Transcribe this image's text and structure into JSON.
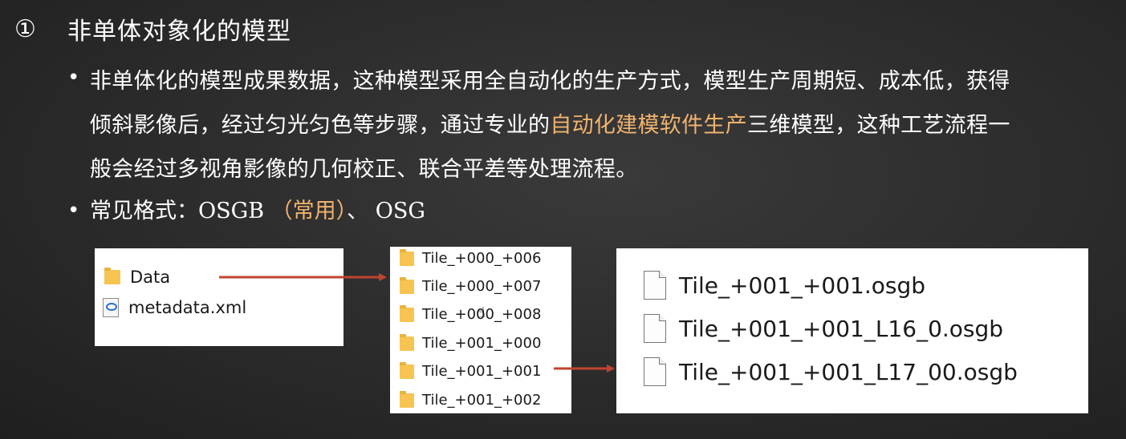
{
  "heading": {
    "number": "①",
    "title": "非单体对象化的模型"
  },
  "bullet_symbol": "•",
  "paragraph": {
    "line1": "非单体化的模型成果数据，这种模型采用全自动化的生产方式，模型生产周期短、成本低，获得",
    "line2_pre": "倾斜影像后，经过匀光匀色等步骤，通过专业的",
    "line2_highlight": "自动化建模软件生产",
    "line2_post": "三维模型，这种工艺流程一",
    "line3": "般会经过多视角影像的几何校正、联合平差等处理流程。"
  },
  "formats": {
    "label": "常见格式：",
    "osgb": "OSGB",
    "common_note": "（常用）",
    "separator": "、",
    "osg": "OSG"
  },
  "panel_root": {
    "items": [
      {
        "label": "Data",
        "icon": "folder-icon"
      },
      {
        "label": "metadata.xml",
        "icon": "xml-file-icon"
      }
    ]
  },
  "panel_tiles": {
    "items": [
      "Tile_+000_+006",
      "Tile_+000_+007",
      "Tile_+000_+008",
      "Tile_+001_+000",
      "Tile_+001_+001",
      "Tile_+001_+002"
    ]
  },
  "panel_files": {
    "items": [
      "Tile_+001_+001.osgb",
      "Tile_+001_+001_L16_0.osgb",
      "Tile_+001_+001_L17_00.osgb"
    ]
  },
  "colors": {
    "highlight": "#f0b36e",
    "arrow": "#c0432f",
    "folder": "#f7c451"
  }
}
